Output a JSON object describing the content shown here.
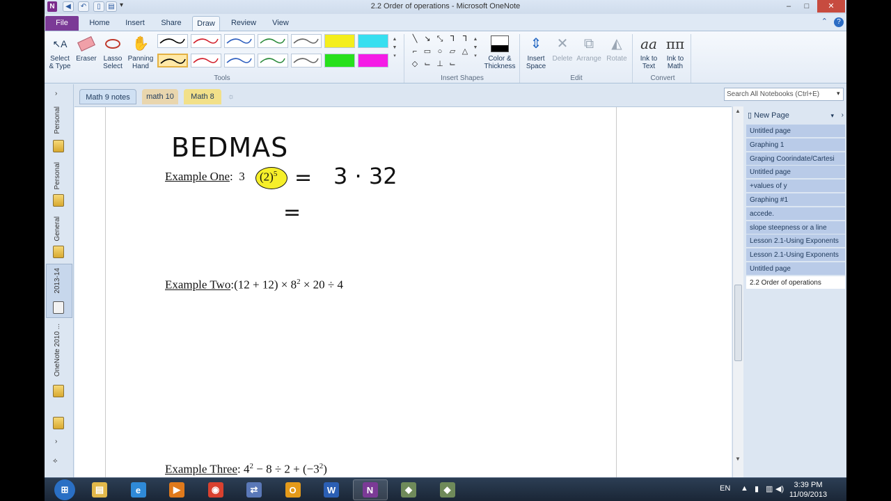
{
  "window": {
    "title": "2.2 Order of operations - Microsoft OneNote",
    "app_icon": "N",
    "controls": [
      "–",
      "□",
      "✕"
    ]
  },
  "ribbon_tabs": [
    {
      "label": "File"
    },
    {
      "label": "Home"
    },
    {
      "label": "Insert"
    },
    {
      "label": "Share"
    },
    {
      "label": "Draw"
    },
    {
      "label": "Review"
    },
    {
      "label": "View"
    }
  ],
  "active_tab": "Draw",
  "ribbon": {
    "tools": {
      "select_label": "Select\n& Type",
      "eraser_label": "Eraser",
      "lasso_label": "Lasso\nSelect",
      "panning_label": "Panning\nHand",
      "group": "Tools"
    },
    "pens": [
      {
        "color": "#000000",
        "selected": false
      },
      {
        "color": "#d21f2b",
        "selected": false
      },
      {
        "color": "#2e5fbf",
        "selected": false
      },
      {
        "color": "#2a8a3a",
        "selected": false
      },
      {
        "color": "#666666",
        "selected": false
      },
      {
        "color": "#f4ee1d",
        "highlighter": true
      },
      {
        "color": "#37dff0",
        "highlighter": true
      },
      {
        "color": "#000000",
        "selected": true
      },
      {
        "color": "#d21f2b",
        "selected": false
      },
      {
        "color": "#2e5fbf",
        "selected": false
      },
      {
        "color": "#2a8a3a",
        "selected": false
      },
      {
        "color": "#666666",
        "selected": false
      },
      {
        "color": "#27e01c",
        "highlighter": true
      },
      {
        "color": "#f51ce6",
        "highlighter": true
      }
    ],
    "shapes_group": "Insert Shapes",
    "color_thickness_label": "Color &\nThickness",
    "edit": {
      "insert_space": "Insert\nSpace",
      "delete": "Delete",
      "arrange": "Arrange",
      "rotate": "Rotate",
      "group": "Edit"
    },
    "convert": {
      "ink_to_text": "Ink to\nText",
      "ink_to_math": "Ink to\nMath",
      "group": "Convert"
    }
  },
  "section_tabs": [
    {
      "label": "Math 9 notes",
      "color": "#cfe0f3",
      "active": true
    },
    {
      "label": "math 10",
      "color": "#e9d6ae"
    },
    {
      "label": "Math 8",
      "color": "#f2e089"
    }
  ],
  "search": {
    "placeholder": "Search All Notebooks (Ctrl+E)"
  },
  "notebooks": [
    {
      "label": "Personal"
    },
    {
      "label": "Personal"
    },
    {
      "label": "General"
    },
    {
      "label": "2013-14"
    },
    {
      "label": "OneNote 2010 ..."
    }
  ],
  "page_content": {
    "heading": "BEDMAS",
    "example_one": {
      "label": "Example One",
      "expr_base": "3",
      "expr_paren": "(2)",
      "expr_exp": "5",
      "ink_eq": "=",
      "ink_result": "3 · 32",
      "ink_eq2": "="
    },
    "example_two": {
      "label": "Example Two",
      "expr": "(12 + 12) × 8",
      "exp": "2",
      "expr_rest": " × 20 ÷ 4"
    },
    "example_three": {
      "label": "Example Three",
      "expr_a": " 4",
      "exp_a": "2",
      "expr_b": " − 8 ÷ 2 + (−3",
      "exp_b": "2",
      "expr_c": ")"
    }
  },
  "pages_pane": {
    "new_page": "New Page",
    "pages": [
      "Untitled page",
      "Graphing 1",
      "Graping Coorindate/Cartesi",
      "Untitled page",
      "+values of y",
      "Graphing #1",
      "accede.",
      "slope steepness or a line",
      "Lesson 2.1-Using Exponents",
      "Lesson 2.1-Using Exponents",
      "Untitled page",
      "2.2 Order of operations"
    ],
    "active_index": 11
  },
  "taskbar": {
    "language": "EN",
    "time": "3:39 PM",
    "date": "11/09/2013",
    "apps": [
      {
        "name": "start-orb",
        "color": "#2a6fc4"
      },
      {
        "name": "explorer",
        "color": "#e2b84a"
      },
      {
        "name": "internet-explorer",
        "color": "#2f8ad8"
      },
      {
        "name": "media-player",
        "color": "#e07a1c"
      },
      {
        "name": "chrome",
        "color": "#d9412f"
      },
      {
        "name": "network-app",
        "color": "#5a78b8"
      },
      {
        "name": "outlook",
        "color": "#e49a1a"
      },
      {
        "name": "word",
        "color": "#2b5fb4"
      },
      {
        "name": "onenote",
        "color": "#7b3a96"
      },
      {
        "name": "app-diamond-1",
        "color": "#6f8a5a"
      },
      {
        "name": "app-diamond-2",
        "color": "#6f8a5a"
      }
    ]
  }
}
